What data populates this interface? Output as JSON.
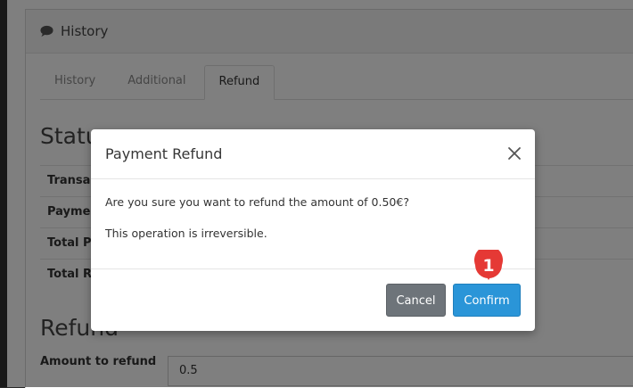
{
  "panel": {
    "title": "History",
    "icon": "comment-icon"
  },
  "tabs": [
    {
      "label": "History"
    },
    {
      "label": "Additional"
    },
    {
      "label": "Refund"
    }
  ],
  "status_section": {
    "title": "Status",
    "rows": [
      {
        "label": "Transaction"
      },
      {
        "label": "Payment"
      },
      {
        "label": "Total Paid"
      },
      {
        "label": "Total Refunded"
      }
    ]
  },
  "refund_section": {
    "title": "Refund",
    "amount_label": "Amount to refund",
    "amount_value": "0.5"
  },
  "modal": {
    "title": "Payment Refund",
    "message": "Are you sure you want to refund the amount of 0.50€?",
    "warning": "This operation is irreversible.",
    "cancel_label": "Cancel",
    "confirm_label": "Confirm"
  },
  "annotation": {
    "number": "1",
    "color": "#e53935"
  },
  "colors": {
    "confirm": "#2a95d8",
    "cancel": "#6e747a"
  }
}
